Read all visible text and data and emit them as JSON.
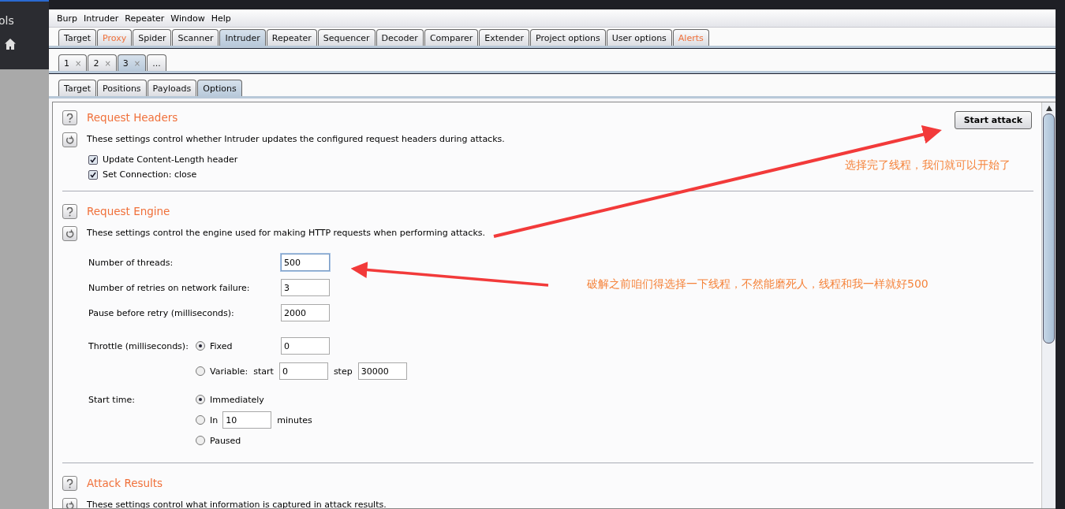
{
  "sidebar": {
    "label": "ols"
  },
  "menu": [
    "Burp",
    "Intruder",
    "Repeater",
    "Window",
    "Help"
  ],
  "main_tabs": [
    {
      "label": "Target",
      "selected": false,
      "alert": false
    },
    {
      "label": "Proxy",
      "selected": false,
      "alert": true
    },
    {
      "label": "Spider",
      "selected": false,
      "alert": false
    },
    {
      "label": "Scanner",
      "selected": false,
      "alert": false
    },
    {
      "label": "Intruder",
      "selected": true,
      "alert": false
    },
    {
      "label": "Repeater",
      "selected": false,
      "alert": false
    },
    {
      "label": "Sequencer",
      "selected": false,
      "alert": false
    },
    {
      "label": "Decoder",
      "selected": false,
      "alert": false
    },
    {
      "label": "Comparer",
      "selected": false,
      "alert": false
    },
    {
      "label": "Extender",
      "selected": false,
      "alert": false
    },
    {
      "label": "Project options",
      "selected": false,
      "alert": false
    },
    {
      "label": "User options",
      "selected": false,
      "alert": false
    },
    {
      "label": "Alerts",
      "selected": false,
      "alert": true
    }
  ],
  "attack_tabs": [
    {
      "label": "1",
      "close": "×",
      "selected": false
    },
    {
      "label": "2",
      "close": "×",
      "selected": false
    },
    {
      "label": "3",
      "close": "×",
      "selected": true
    },
    {
      "label": "...",
      "selected": false
    }
  ],
  "sub_tabs": [
    {
      "label": "Target",
      "selected": false
    },
    {
      "label": "Positions",
      "selected": false
    },
    {
      "label": "Payloads",
      "selected": false
    },
    {
      "label": "Options",
      "selected": true
    }
  ],
  "start_button": "Start attack",
  "request_headers": {
    "title": "Request Headers",
    "description": "These settings control whether Intruder updates the configured request headers during attacks.",
    "options": [
      {
        "label": "Update Content-Length header",
        "checked": true
      },
      {
        "label": "Set Connection: close",
        "checked": true
      }
    ]
  },
  "request_engine": {
    "title": "Request Engine",
    "description": "These settings control the engine used for making HTTP requests when performing attacks.",
    "fields": [
      {
        "label": "Number of threads:",
        "value": "500",
        "focused": true
      },
      {
        "label": "Number of retries on network failure:",
        "value": "3",
        "focused": false
      },
      {
        "label": "Pause before retry (milliseconds):",
        "value": "2000",
        "focused": false
      }
    ],
    "throttle": {
      "label": "Throttle (milliseconds):",
      "options": [
        {
          "kind": "fixed",
          "label": "Fixed",
          "value": "0",
          "selected": true
        },
        {
          "kind": "variable",
          "label": "Variable:",
          "start_label": "start",
          "start": "0",
          "step_label": "step",
          "step": "30000",
          "selected": false
        }
      ]
    },
    "start_time": {
      "label": "Start time:",
      "options": [
        {
          "kind": "plain",
          "label": "Immediately",
          "selected": true
        },
        {
          "kind": "delay",
          "label": "In",
          "value": "10",
          "unit": "minutes",
          "selected": false
        },
        {
          "kind": "plain",
          "label": "Paused",
          "selected": false
        }
      ]
    }
  },
  "attack_results": {
    "title": "Attack Results",
    "description": "These settings control what information is captured in attack results."
  },
  "annotations": [
    {
      "text": "选择完了线程，我们就可以开始了"
    },
    {
      "text": "破解之前咱们得选择一下线程，不然能磨死人，线程和我一样就好500"
    }
  ]
}
